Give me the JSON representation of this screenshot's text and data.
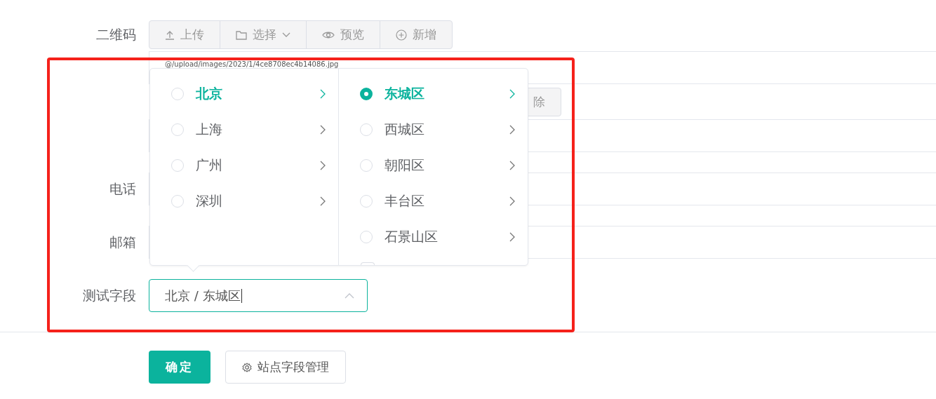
{
  "upload_field": {
    "label": "二维码",
    "toolbar": [
      {
        "label": "上传",
        "dropdown": false
      },
      {
        "label": "选择",
        "dropdown": true
      },
      {
        "label": "预览",
        "dropdown": false
      },
      {
        "label": "新增",
        "dropdown": false
      }
    ],
    "path": "@/upload/images/2023/1/4ce8708ec4b14086.jpg",
    "delete_button": "除"
  },
  "phone": {
    "label": "电话"
  },
  "email": {
    "label": "邮箱"
  },
  "cascader": {
    "label": "测试字段",
    "value": "北京 / 东城区",
    "expanded": true,
    "columns": [
      [
        {
          "label": "北京",
          "selected": false,
          "active": true
        },
        {
          "label": "上海",
          "selected": false,
          "active": false
        },
        {
          "label": "广州",
          "selected": false,
          "active": false
        },
        {
          "label": "深圳",
          "selected": false,
          "active": false
        }
      ],
      [
        {
          "label": "东城区",
          "selected": true,
          "active": true
        },
        {
          "label": "西城区",
          "selected": false,
          "active": false
        },
        {
          "label": "朝阳区",
          "selected": false,
          "active": false
        },
        {
          "label": "丰台区",
          "selected": false,
          "active": false
        },
        {
          "label": "石景山区",
          "selected": false,
          "active": false
        }
      ]
    ]
  },
  "actions": [
    {
      "label": "确定",
      "kind": "primary"
    },
    {
      "label": "站点字段管理",
      "kind": "settings"
    }
  ]
}
